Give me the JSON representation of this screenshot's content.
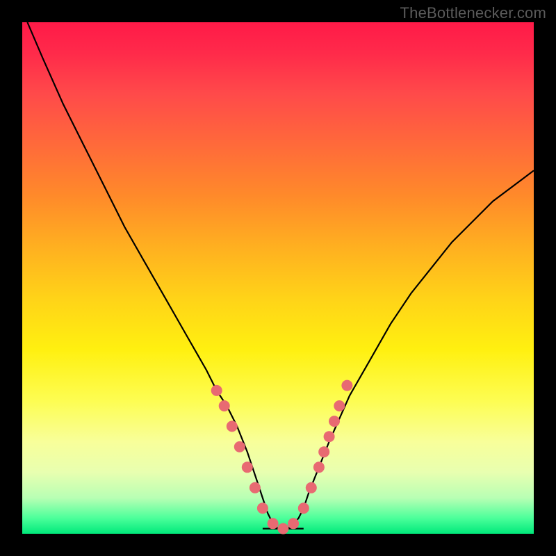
{
  "watermark": "TheBottlenecker.com",
  "chart_data": {
    "type": "line",
    "title": "",
    "xlabel": "",
    "ylabel": "",
    "xlim": [
      0,
      100
    ],
    "ylim": [
      0,
      100
    ],
    "series": [
      {
        "name": "bottleneck-curve",
        "x": [
          1,
          4,
          8,
          12,
          16,
          20,
          24,
          28,
          32,
          36,
          38,
          40,
          42,
          44,
          45,
          46,
          47,
          48,
          49,
          50,
          51,
          52,
          53,
          54,
          55,
          56,
          58,
          60,
          64,
          68,
          72,
          76,
          80,
          84,
          88,
          92,
          96,
          100
        ],
        "y": [
          100,
          93,
          84,
          76,
          68,
          60,
          53,
          46,
          39,
          32,
          28,
          25,
          21,
          16,
          13,
          10,
          7,
          4,
          2,
          1,
          1,
          1,
          2,
          3,
          5,
          8,
          13,
          18,
          27,
          34,
          41,
          47,
          52,
          57,
          61,
          65,
          68,
          71
        ]
      }
    ],
    "markers": {
      "name": "highlight-dots",
      "coords": [
        [
          38,
          28
        ],
        [
          39.5,
          25
        ],
        [
          41,
          21
        ],
        [
          42.5,
          17
        ],
        [
          44,
          13
        ],
        [
          45.5,
          9
        ],
        [
          47,
          5
        ],
        [
          49,
          2
        ],
        [
          51,
          1
        ],
        [
          53,
          2
        ],
        [
          55,
          5
        ],
        [
          56.5,
          9
        ],
        [
          58,
          13
        ],
        [
          59,
          16
        ],
        [
          60,
          19
        ],
        [
          61,
          22
        ],
        [
          62,
          25
        ],
        [
          63.5,
          29
        ]
      ]
    },
    "baseline_y": 1
  }
}
